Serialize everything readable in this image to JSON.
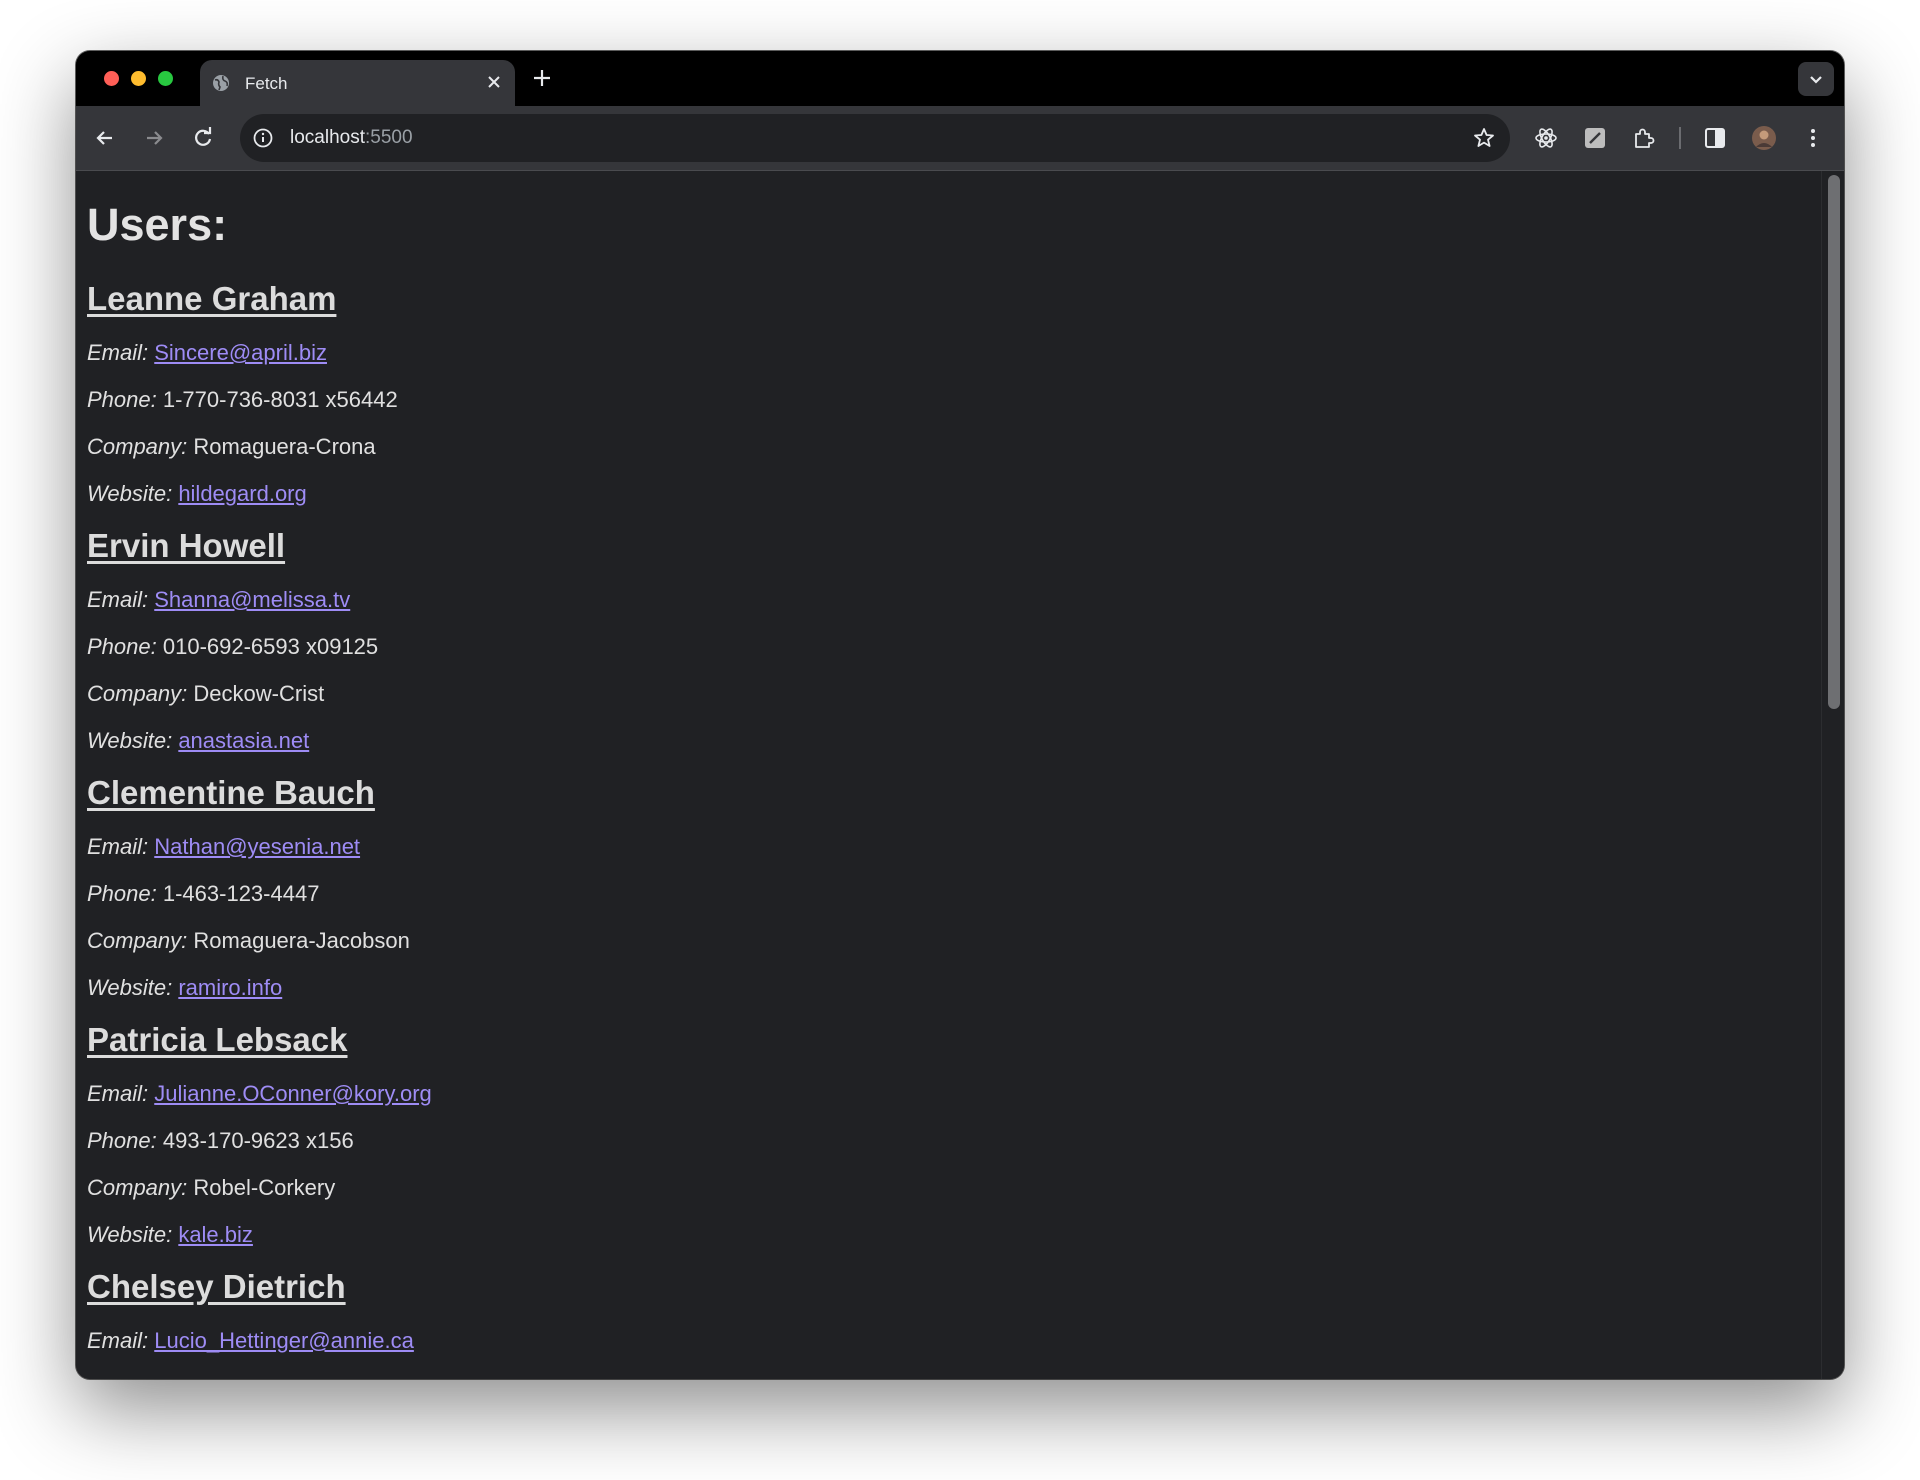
{
  "browser": {
    "tab_title": "Fetch",
    "url_host": "localhost",
    "url_port": ":5500"
  },
  "page": {
    "heading": "Users:",
    "labels": {
      "email": "Email:",
      "phone": "Phone:",
      "company": "Company:",
      "website": "Website:"
    },
    "users": [
      {
        "name": "Leanne Graham",
        "email": "Sincere@april.biz",
        "phone": "1-770-736-8031 x56442",
        "company": "Romaguera-Crona",
        "website": "hildegard.org"
      },
      {
        "name": "Ervin Howell",
        "email": "Shanna@melissa.tv",
        "phone": "010-692-6593 x09125",
        "company": "Deckow-Crist",
        "website": "anastasia.net"
      },
      {
        "name": "Clementine Bauch",
        "email": "Nathan@yesenia.net",
        "phone": "1-463-123-4447",
        "company": "Romaguera-Jacobson",
        "website": "ramiro.info"
      },
      {
        "name": "Patricia Lebsack",
        "email": "Julianne.OConner@kory.org",
        "phone": "493-170-9623 x156",
        "company": "Robel-Corkery",
        "website": "kale.biz"
      },
      {
        "name": "Chelsey Dietrich",
        "email": "Lucio_Hettinger@annie.ca",
        "phone": "",
        "company": "",
        "website": ""
      }
    ]
  },
  "colors": {
    "background": "#202124",
    "link": "#9e8cf5",
    "text": "#e8eaed"
  }
}
